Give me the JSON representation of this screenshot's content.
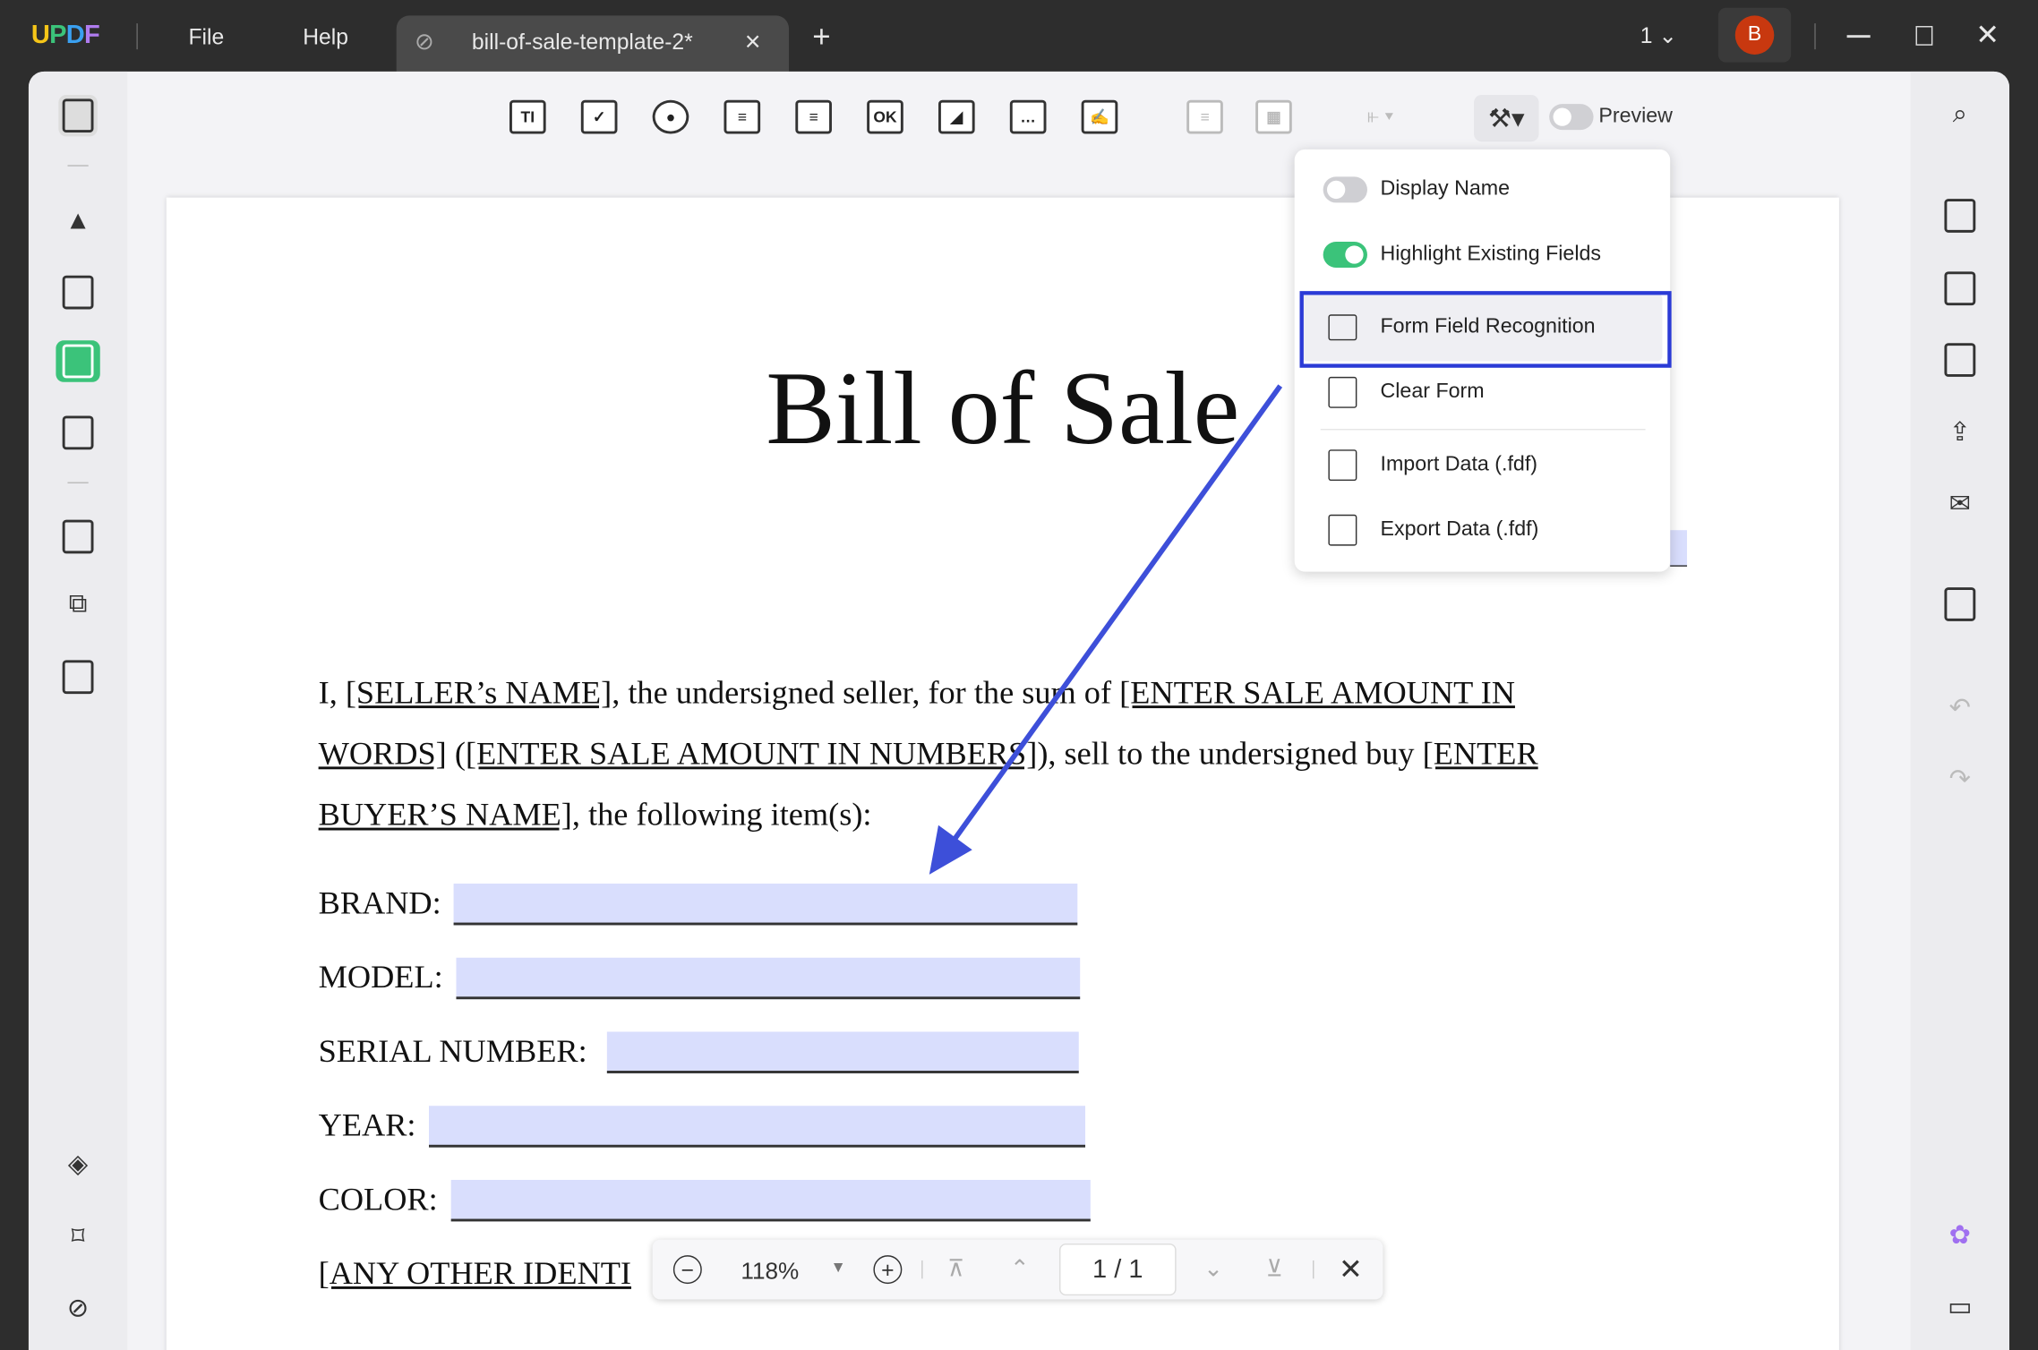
{
  "titlebar": {
    "logo": "UPDF",
    "menu": [
      "File",
      "Help"
    ],
    "tab_title": "bill-of-sale-template-2*",
    "tab_close": "×",
    "new_tab": "+",
    "window_count": "1",
    "avatar_initial": "B",
    "avatar_color": "#c8380f"
  },
  "toolbar": {
    "tools": [
      "text-field",
      "checkbox",
      "radio-button",
      "dropdown",
      "list-box",
      "button",
      "image-field",
      "date-field",
      "signature-field"
    ],
    "button_tool_label": "OK",
    "text_tool_label": "TI",
    "preview_label": "Preview"
  },
  "menu": {
    "items": [
      {
        "label": "Display Name",
        "toggle": false
      },
      {
        "label": "Highlight Existing Fields",
        "toggle": true
      },
      {
        "label": "Form Field Recognition",
        "highlighted": true
      },
      {
        "label": "Clear Form"
      },
      {
        "label": "Import Data (.fdf)"
      },
      {
        "label": "Export Data (.fdf)"
      }
    ]
  },
  "document": {
    "title": "Bill of Sale",
    "para": {
      "p1": "I, ",
      "seller": "[SELLER’s NAME]",
      "p2": ", the undersigned seller, for the sum of ",
      "amount_words_a": "[ENTER SALE AMOUNT IN",
      "amount_words_b": "WORDS]",
      "p3": " (",
      "amount_num": "[ENTER SALE AMOUNT IN NUMBERS]",
      "p4": "), sell to the undersigned buy ",
      "buyer_a": "[ENTER",
      "buyer_b": "BUYER’S NAME]",
      "p5": ", the following item(s):"
    },
    "fields": [
      "BRAND:",
      "MODEL:",
      "SERIAL NUMBER:",
      "YEAR:",
      "COLOR:"
    ],
    "other": "[ANY OTHER IDENTI"
  },
  "bottombar": {
    "zoom": "118%",
    "page": "1 / 1"
  },
  "colors": {
    "accent": "#2b3bd6",
    "field_highlight": "#d9defd",
    "toggle_on": "#3bc37a"
  }
}
